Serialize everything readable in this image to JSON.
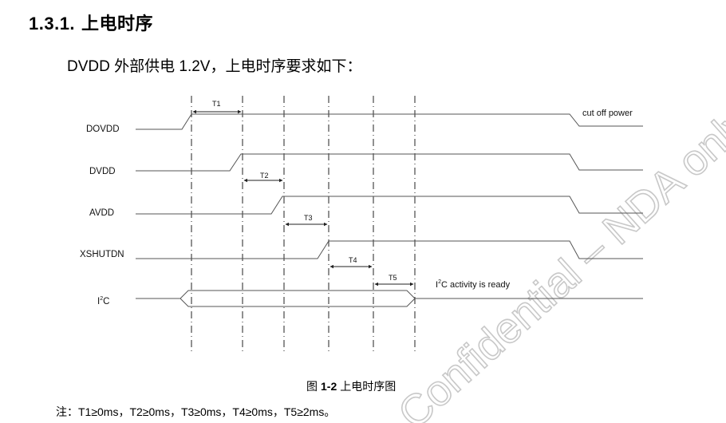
{
  "section": {
    "number": "1.3.1.",
    "title": "上电时序"
  },
  "intro": "DVDD 外部供电 1.2V，上电时序要求如下：",
  "timing_diagram": {
    "signals": [
      {
        "name": "DOVDD",
        "label": "DOVDD"
      },
      {
        "name": "DVDD",
        "label": "DVDD"
      },
      {
        "name": "AVDD",
        "label": "AVDD"
      },
      {
        "name": "XSHUTDN",
        "label": "XSHUTDN"
      },
      {
        "name": "I2C",
        "label": "I",
        "sup": "2",
        "label_tail": "C"
      }
    ],
    "intervals": [
      "T1",
      "T2",
      "T3",
      "T4",
      "T5"
    ],
    "annotations": {
      "cut_off": "cut off power",
      "i2c_ready_prefix": "I",
      "i2c_ready_sup": "2",
      "i2c_ready_tail": "C activity is ready"
    }
  },
  "watermark": "Confidential – NDA only",
  "caption": {
    "prefix": "图",
    "number": "1-2",
    "title": "上电时序图"
  },
  "note": "注：T1≥0ms，T2≥0ms，T3≥0ms，T4≥0ms，T5≥2ms。"
}
